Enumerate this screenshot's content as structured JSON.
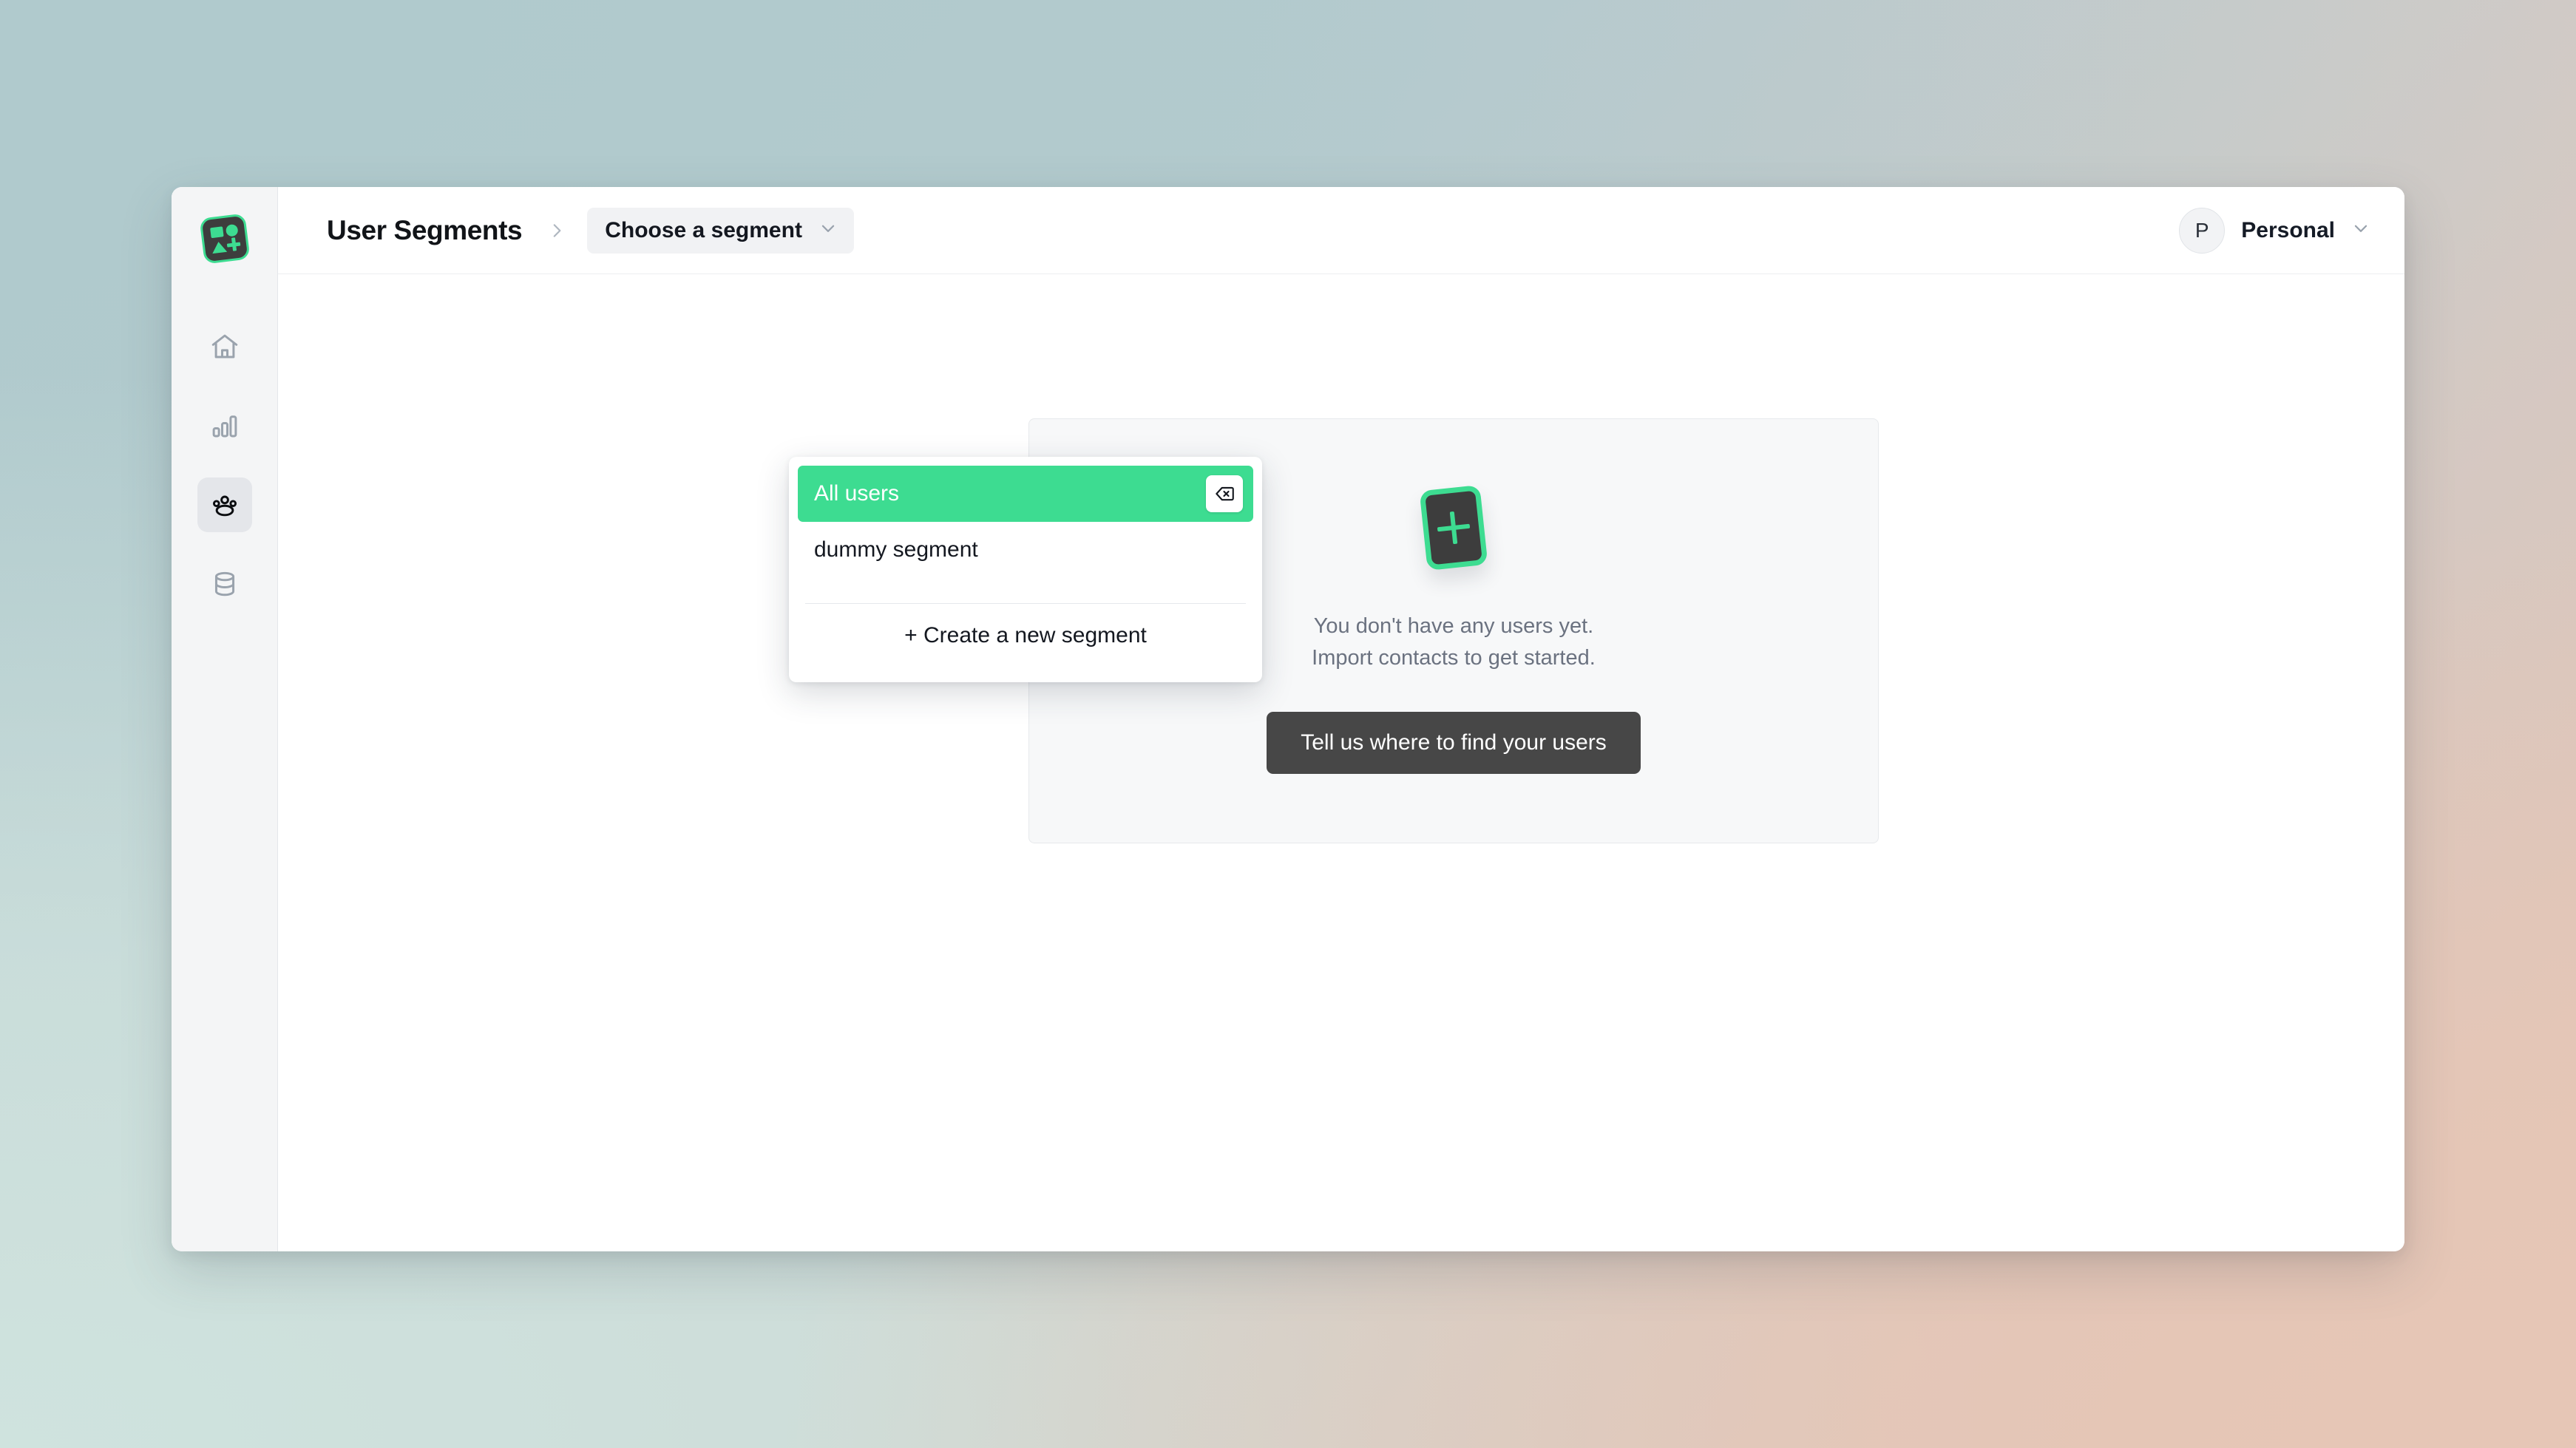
{
  "window": {
    "title": "User Segments"
  },
  "sidebar": {
    "logo": {
      "icon": "shapes-logo-icon"
    },
    "items": [
      {
        "icon": "home-icon",
        "name": "home",
        "active": false
      },
      {
        "icon": "bar-chart-icon",
        "name": "analytics",
        "active": false
      },
      {
        "icon": "users-icon",
        "name": "users",
        "active": true
      },
      {
        "icon": "database-icon",
        "name": "data",
        "active": false
      }
    ]
  },
  "topbar": {
    "page_title": "User Segments",
    "breadcrumb_separator_icon": "chevron-right-icon",
    "segment_select": {
      "label": "Choose a segment",
      "chevron_icon": "chevron-down-icon"
    },
    "account": {
      "avatar_initial": "P",
      "name": "Personal",
      "chevron_icon": "chevron-down-icon"
    }
  },
  "segment_dropdown": {
    "options": [
      {
        "label": "All users",
        "selected": true,
        "delete_icon": "backspace-delete-icon"
      },
      {
        "label": "dummy segment",
        "selected": false,
        "delete_icon": null
      }
    ],
    "create_label": "+ Create a new segment"
  },
  "empty_state": {
    "icon": "add-card-icon",
    "line1": "You don't have any users yet.",
    "line2": "Import contacts to get started.",
    "cta_label": "Tell us where to find your users"
  },
  "colors": {
    "accent_green": "#3ddc91",
    "cta_dark": "#474747",
    "text_primary": "#141820",
    "text_muted": "#6b7280",
    "rail_bg": "#f4f5f6",
    "card_bg": "#f7f8f9"
  }
}
